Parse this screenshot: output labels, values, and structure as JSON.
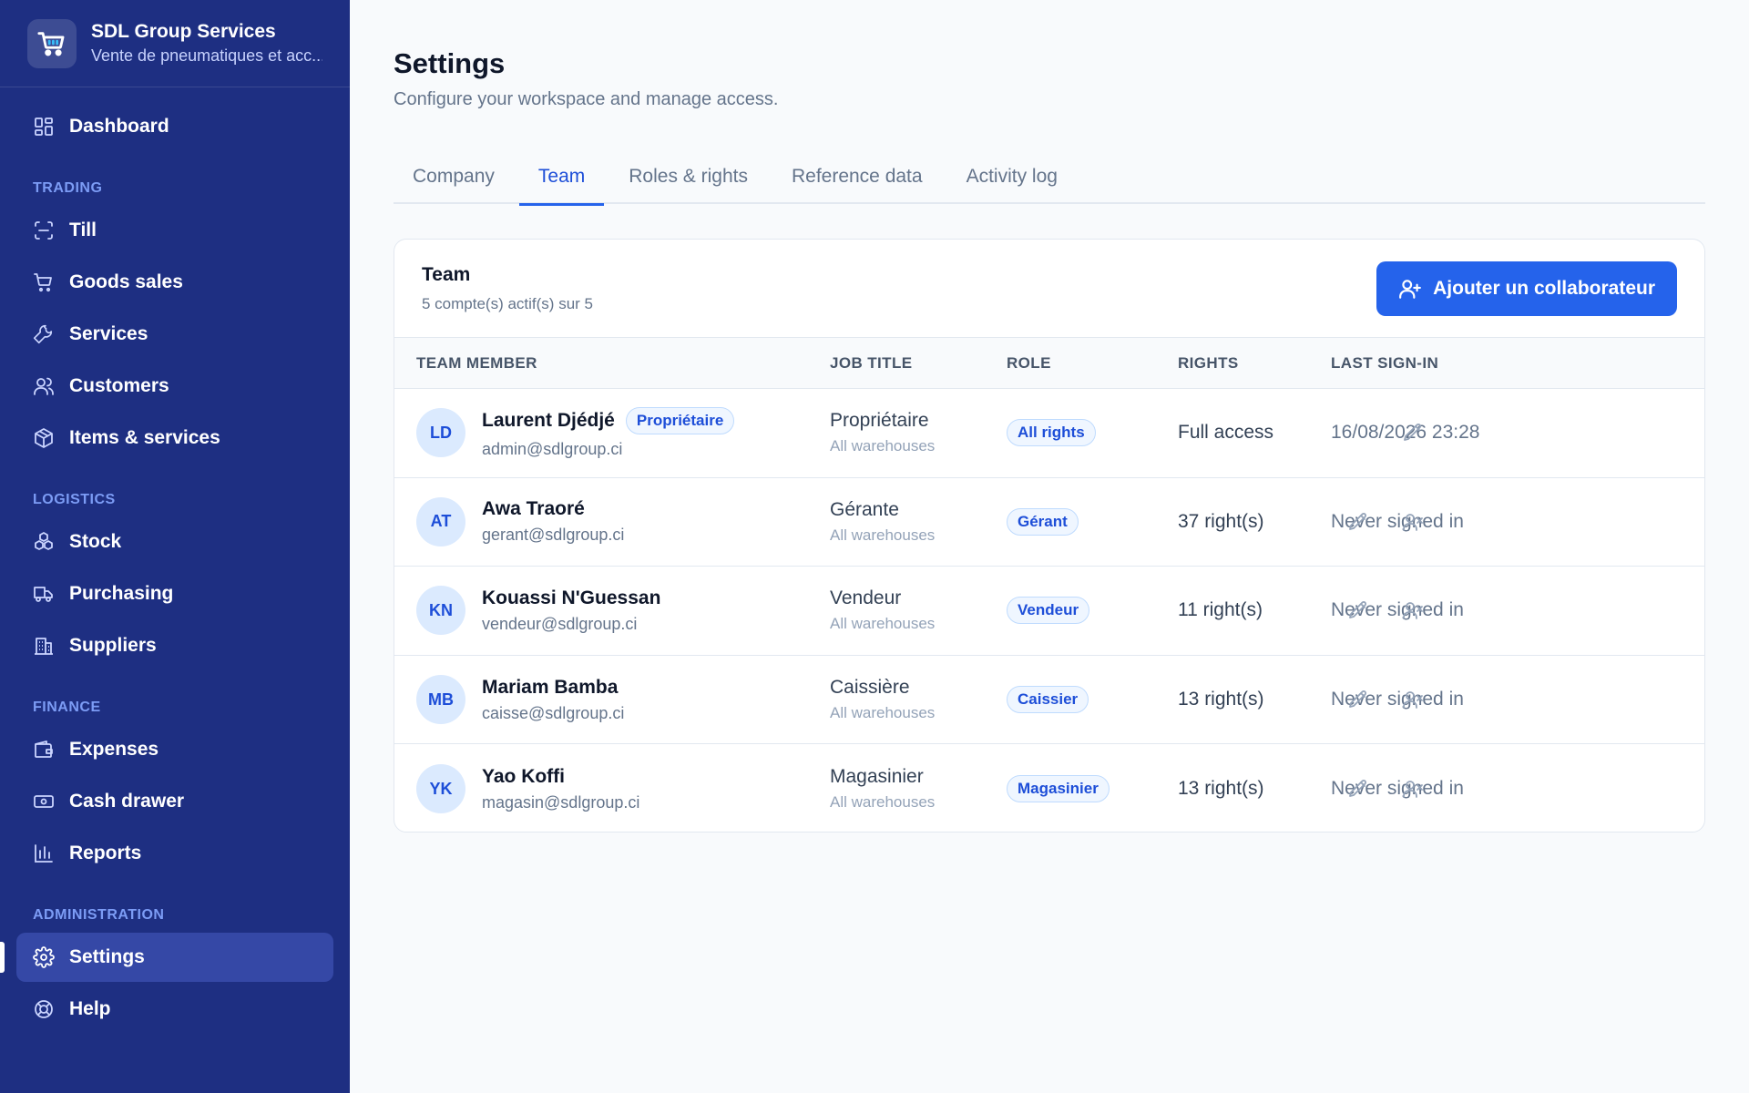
{
  "brand": {
    "name": "SDL Group Services",
    "subtitle": "Vente de pneumatiques et acc..."
  },
  "nav": {
    "dashboard": "Dashboard",
    "sections": {
      "trading": "TRADING",
      "logistics": "LOGISTICS",
      "finance": "FINANCE",
      "administration": "ADMINISTRATION"
    },
    "trading": [
      "Till",
      "Goods sales",
      "Services",
      "Customers",
      "Items & services"
    ],
    "logistics": [
      "Stock",
      "Purchasing",
      "Suppliers"
    ],
    "finance": [
      "Expenses",
      "Cash drawer",
      "Reports"
    ],
    "administration": [
      "Settings",
      "Help"
    ],
    "active": "Settings"
  },
  "page": {
    "title": "Settings",
    "subtitle": "Configure your workspace and manage access."
  },
  "tabs": [
    "Company",
    "Team",
    "Roles & rights",
    "Reference data",
    "Activity log"
  ],
  "active_tab": "Team",
  "team": {
    "title": "Team",
    "subtitle": "5 compte(s) actif(s) sur 5",
    "add_button": "Ajouter un collaborateur",
    "columns": [
      "TEAM MEMBER",
      "JOB TITLE",
      "ROLE",
      "RIGHTS",
      "LAST SIGN-IN"
    ],
    "members": [
      {
        "initials": "LD",
        "name": "Laurent Djédjé",
        "badge": "Propriétaire",
        "email": "admin@sdlgroup.ci",
        "job": "Propriétaire",
        "scope": "All warehouses",
        "role": "All rights",
        "rights": "Full access",
        "last_signin": "16/08/2026 23:28",
        "can_deactivate": false
      },
      {
        "initials": "AT",
        "name": "Awa Traoré",
        "badge": "",
        "email": "gerant@sdlgroup.ci",
        "job": "Gérante",
        "scope": "All warehouses",
        "role": "Gérant",
        "rights": "37 right(s)",
        "last_signin": "Never signed in",
        "can_deactivate": true
      },
      {
        "initials": "KN",
        "name": "Kouassi N'Guessan",
        "badge": "",
        "email": "vendeur@sdlgroup.ci",
        "job": "Vendeur",
        "scope": "All warehouses",
        "role": "Vendeur",
        "rights": "11 right(s)",
        "last_signin": "Never signed in",
        "can_deactivate": true
      },
      {
        "initials": "MB",
        "name": "Mariam Bamba",
        "badge": "",
        "email": "caisse@sdlgroup.ci",
        "job": "Caissière",
        "scope": "All warehouses",
        "role": "Caissier",
        "rights": "13 right(s)",
        "last_signin": "Never signed in",
        "can_deactivate": true
      },
      {
        "initials": "YK",
        "name": "Yao Koffi",
        "badge": "",
        "email": "magasin@sdlgroup.ci",
        "job": "Magasinier",
        "scope": "All warehouses",
        "role": "Magasinier",
        "rights": "13 right(s)",
        "last_signin": "Never signed in",
        "can_deactivate": true
      }
    ]
  },
  "colors": {
    "sidebar": "#1e2f82",
    "sidebar_active": "#3548a6",
    "accent": "#2563eb",
    "section_label": "#7c9cf5"
  }
}
